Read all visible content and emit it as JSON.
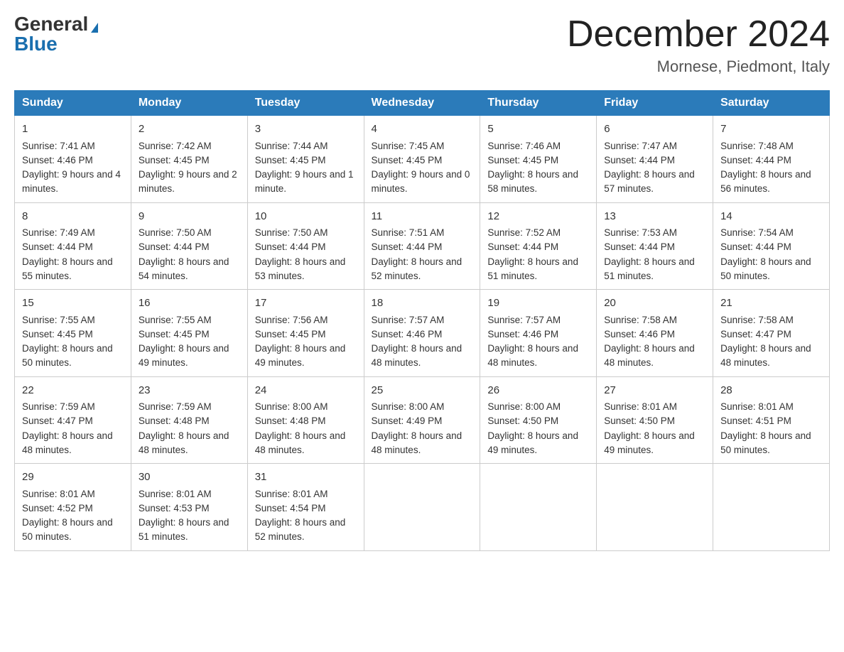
{
  "header": {
    "logo_general": "General",
    "logo_blue": "Blue",
    "month_title": "December 2024",
    "location": "Mornese, Piedmont, Italy"
  },
  "days_of_week": [
    "Sunday",
    "Monday",
    "Tuesday",
    "Wednesday",
    "Thursday",
    "Friday",
    "Saturday"
  ],
  "weeks": [
    [
      {
        "day": "1",
        "sunrise": "7:41 AM",
        "sunset": "4:46 PM",
        "daylight": "9 hours and 4 minutes."
      },
      {
        "day": "2",
        "sunrise": "7:42 AM",
        "sunset": "4:45 PM",
        "daylight": "9 hours and 2 minutes."
      },
      {
        "day": "3",
        "sunrise": "7:44 AM",
        "sunset": "4:45 PM",
        "daylight": "9 hours and 1 minute."
      },
      {
        "day": "4",
        "sunrise": "7:45 AM",
        "sunset": "4:45 PM",
        "daylight": "9 hours and 0 minutes."
      },
      {
        "day": "5",
        "sunrise": "7:46 AM",
        "sunset": "4:45 PM",
        "daylight": "8 hours and 58 minutes."
      },
      {
        "day": "6",
        "sunrise": "7:47 AM",
        "sunset": "4:44 PM",
        "daylight": "8 hours and 57 minutes."
      },
      {
        "day": "7",
        "sunrise": "7:48 AM",
        "sunset": "4:44 PM",
        "daylight": "8 hours and 56 minutes."
      }
    ],
    [
      {
        "day": "8",
        "sunrise": "7:49 AM",
        "sunset": "4:44 PM",
        "daylight": "8 hours and 55 minutes."
      },
      {
        "day": "9",
        "sunrise": "7:50 AM",
        "sunset": "4:44 PM",
        "daylight": "8 hours and 54 minutes."
      },
      {
        "day": "10",
        "sunrise": "7:50 AM",
        "sunset": "4:44 PM",
        "daylight": "8 hours and 53 minutes."
      },
      {
        "day": "11",
        "sunrise": "7:51 AM",
        "sunset": "4:44 PM",
        "daylight": "8 hours and 52 minutes."
      },
      {
        "day": "12",
        "sunrise": "7:52 AM",
        "sunset": "4:44 PM",
        "daylight": "8 hours and 51 minutes."
      },
      {
        "day": "13",
        "sunrise": "7:53 AM",
        "sunset": "4:44 PM",
        "daylight": "8 hours and 51 minutes."
      },
      {
        "day": "14",
        "sunrise": "7:54 AM",
        "sunset": "4:44 PM",
        "daylight": "8 hours and 50 minutes."
      }
    ],
    [
      {
        "day": "15",
        "sunrise": "7:55 AM",
        "sunset": "4:45 PM",
        "daylight": "8 hours and 50 minutes."
      },
      {
        "day": "16",
        "sunrise": "7:55 AM",
        "sunset": "4:45 PM",
        "daylight": "8 hours and 49 minutes."
      },
      {
        "day": "17",
        "sunrise": "7:56 AM",
        "sunset": "4:45 PM",
        "daylight": "8 hours and 49 minutes."
      },
      {
        "day": "18",
        "sunrise": "7:57 AM",
        "sunset": "4:46 PM",
        "daylight": "8 hours and 48 minutes."
      },
      {
        "day": "19",
        "sunrise": "7:57 AM",
        "sunset": "4:46 PM",
        "daylight": "8 hours and 48 minutes."
      },
      {
        "day": "20",
        "sunrise": "7:58 AM",
        "sunset": "4:46 PM",
        "daylight": "8 hours and 48 minutes."
      },
      {
        "day": "21",
        "sunrise": "7:58 AM",
        "sunset": "4:47 PM",
        "daylight": "8 hours and 48 minutes."
      }
    ],
    [
      {
        "day": "22",
        "sunrise": "7:59 AM",
        "sunset": "4:47 PM",
        "daylight": "8 hours and 48 minutes."
      },
      {
        "day": "23",
        "sunrise": "7:59 AM",
        "sunset": "4:48 PM",
        "daylight": "8 hours and 48 minutes."
      },
      {
        "day": "24",
        "sunrise": "8:00 AM",
        "sunset": "4:48 PM",
        "daylight": "8 hours and 48 minutes."
      },
      {
        "day": "25",
        "sunrise": "8:00 AM",
        "sunset": "4:49 PM",
        "daylight": "8 hours and 48 minutes."
      },
      {
        "day": "26",
        "sunrise": "8:00 AM",
        "sunset": "4:50 PM",
        "daylight": "8 hours and 49 minutes."
      },
      {
        "day": "27",
        "sunrise": "8:01 AM",
        "sunset": "4:50 PM",
        "daylight": "8 hours and 49 minutes."
      },
      {
        "day": "28",
        "sunrise": "8:01 AM",
        "sunset": "4:51 PM",
        "daylight": "8 hours and 50 minutes."
      }
    ],
    [
      {
        "day": "29",
        "sunrise": "8:01 AM",
        "sunset": "4:52 PM",
        "daylight": "8 hours and 50 minutes."
      },
      {
        "day": "30",
        "sunrise": "8:01 AM",
        "sunset": "4:53 PM",
        "daylight": "8 hours and 51 minutes."
      },
      {
        "day": "31",
        "sunrise": "8:01 AM",
        "sunset": "4:54 PM",
        "daylight": "8 hours and 52 minutes."
      },
      null,
      null,
      null,
      null
    ]
  ]
}
